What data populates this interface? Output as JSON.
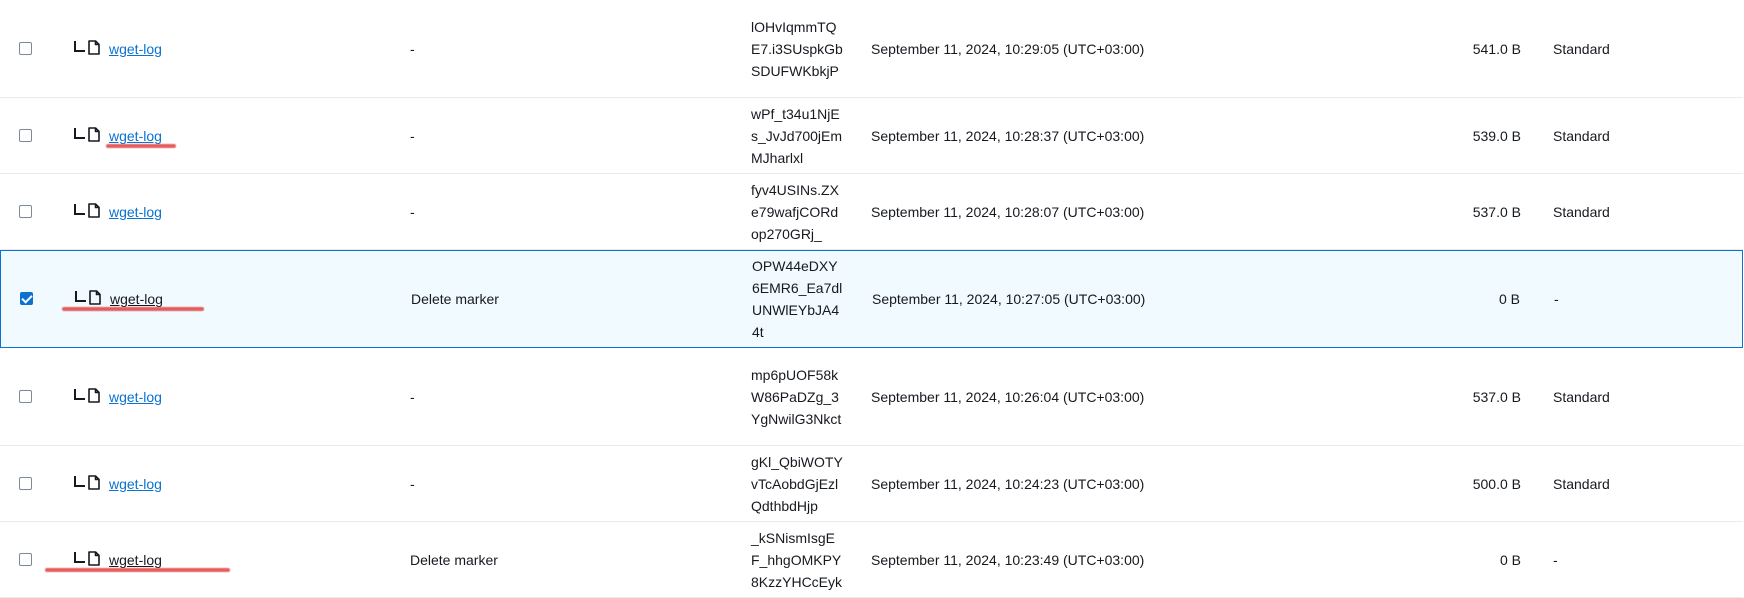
{
  "table": {
    "rows": [
      {
        "name": "wget-log",
        "version_type": "-",
        "version_id": "lOHvIqmmTQE7.i3SUspkGbSDUFWKbkjP",
        "modified": "September 11, 2024, 10:29:05 (UTC+03:00)",
        "size": "541.0 B",
        "storage_class": "Standard",
        "checked": false,
        "link": true
      },
      {
        "name": "wget-log",
        "version_type": "-",
        "version_id": "wPf_t34u1NjEs_JvJd700jEmMJharlxl",
        "modified": "September 11, 2024, 10:28:37 (UTC+03:00)",
        "size": "539.0 B",
        "storage_class": "Standard",
        "checked": false,
        "link": true
      },
      {
        "name": "wget-log",
        "version_type": "-",
        "version_id": "fyv4USINs.ZXe79wafjCORdop270GRj_",
        "modified": "September 11, 2024, 10:28:07 (UTC+03:00)",
        "size": "537.0 B",
        "storage_class": "Standard",
        "checked": false,
        "link": true
      },
      {
        "name": "wget-log",
        "version_type": "Delete marker",
        "version_id": "OPW44eDXY6EMR6_Ea7dlUNWlEYbJA44t",
        "modified": "September 11, 2024, 10:27:05 (UTC+03:00)",
        "size": "0 B",
        "storage_class": "-",
        "checked": true,
        "link": false
      },
      {
        "name": "wget-log",
        "version_type": "-",
        "version_id": "mp6pUOF58kW86PaDZg_3YgNwilG3Nkct",
        "modified": "September 11, 2024, 10:26:04 (UTC+03:00)",
        "size": "537.0 B",
        "storage_class": "Standard",
        "checked": false,
        "link": true
      },
      {
        "name": "wget-log",
        "version_type": "-",
        "version_id": "gKl_QbiWOTYvTcAobdGjEzlQdthbdHjp",
        "modified": "September 11, 2024, 10:24:23 (UTC+03:00)",
        "size": "500.0 B",
        "storage_class": "Standard",
        "checked": false,
        "link": true
      },
      {
        "name": "wget-log",
        "version_type": "Delete marker",
        "version_id": "_kSNismIsgEF_hhgOMKPY8KzzYHCcEyk",
        "modified": "September 11, 2024, 10:23:49 (UTC+03:00)",
        "size": "0 B",
        "storage_class": "-",
        "checked": false,
        "link": false
      }
    ]
  },
  "colors": {
    "link": "#0972d3",
    "selected_bg": "#f1faff",
    "selected_border": "#0972d3",
    "annotation_red": "#dc2828"
  },
  "icons": {
    "tree": "tree-branch-icon",
    "file": "file-icon"
  }
}
